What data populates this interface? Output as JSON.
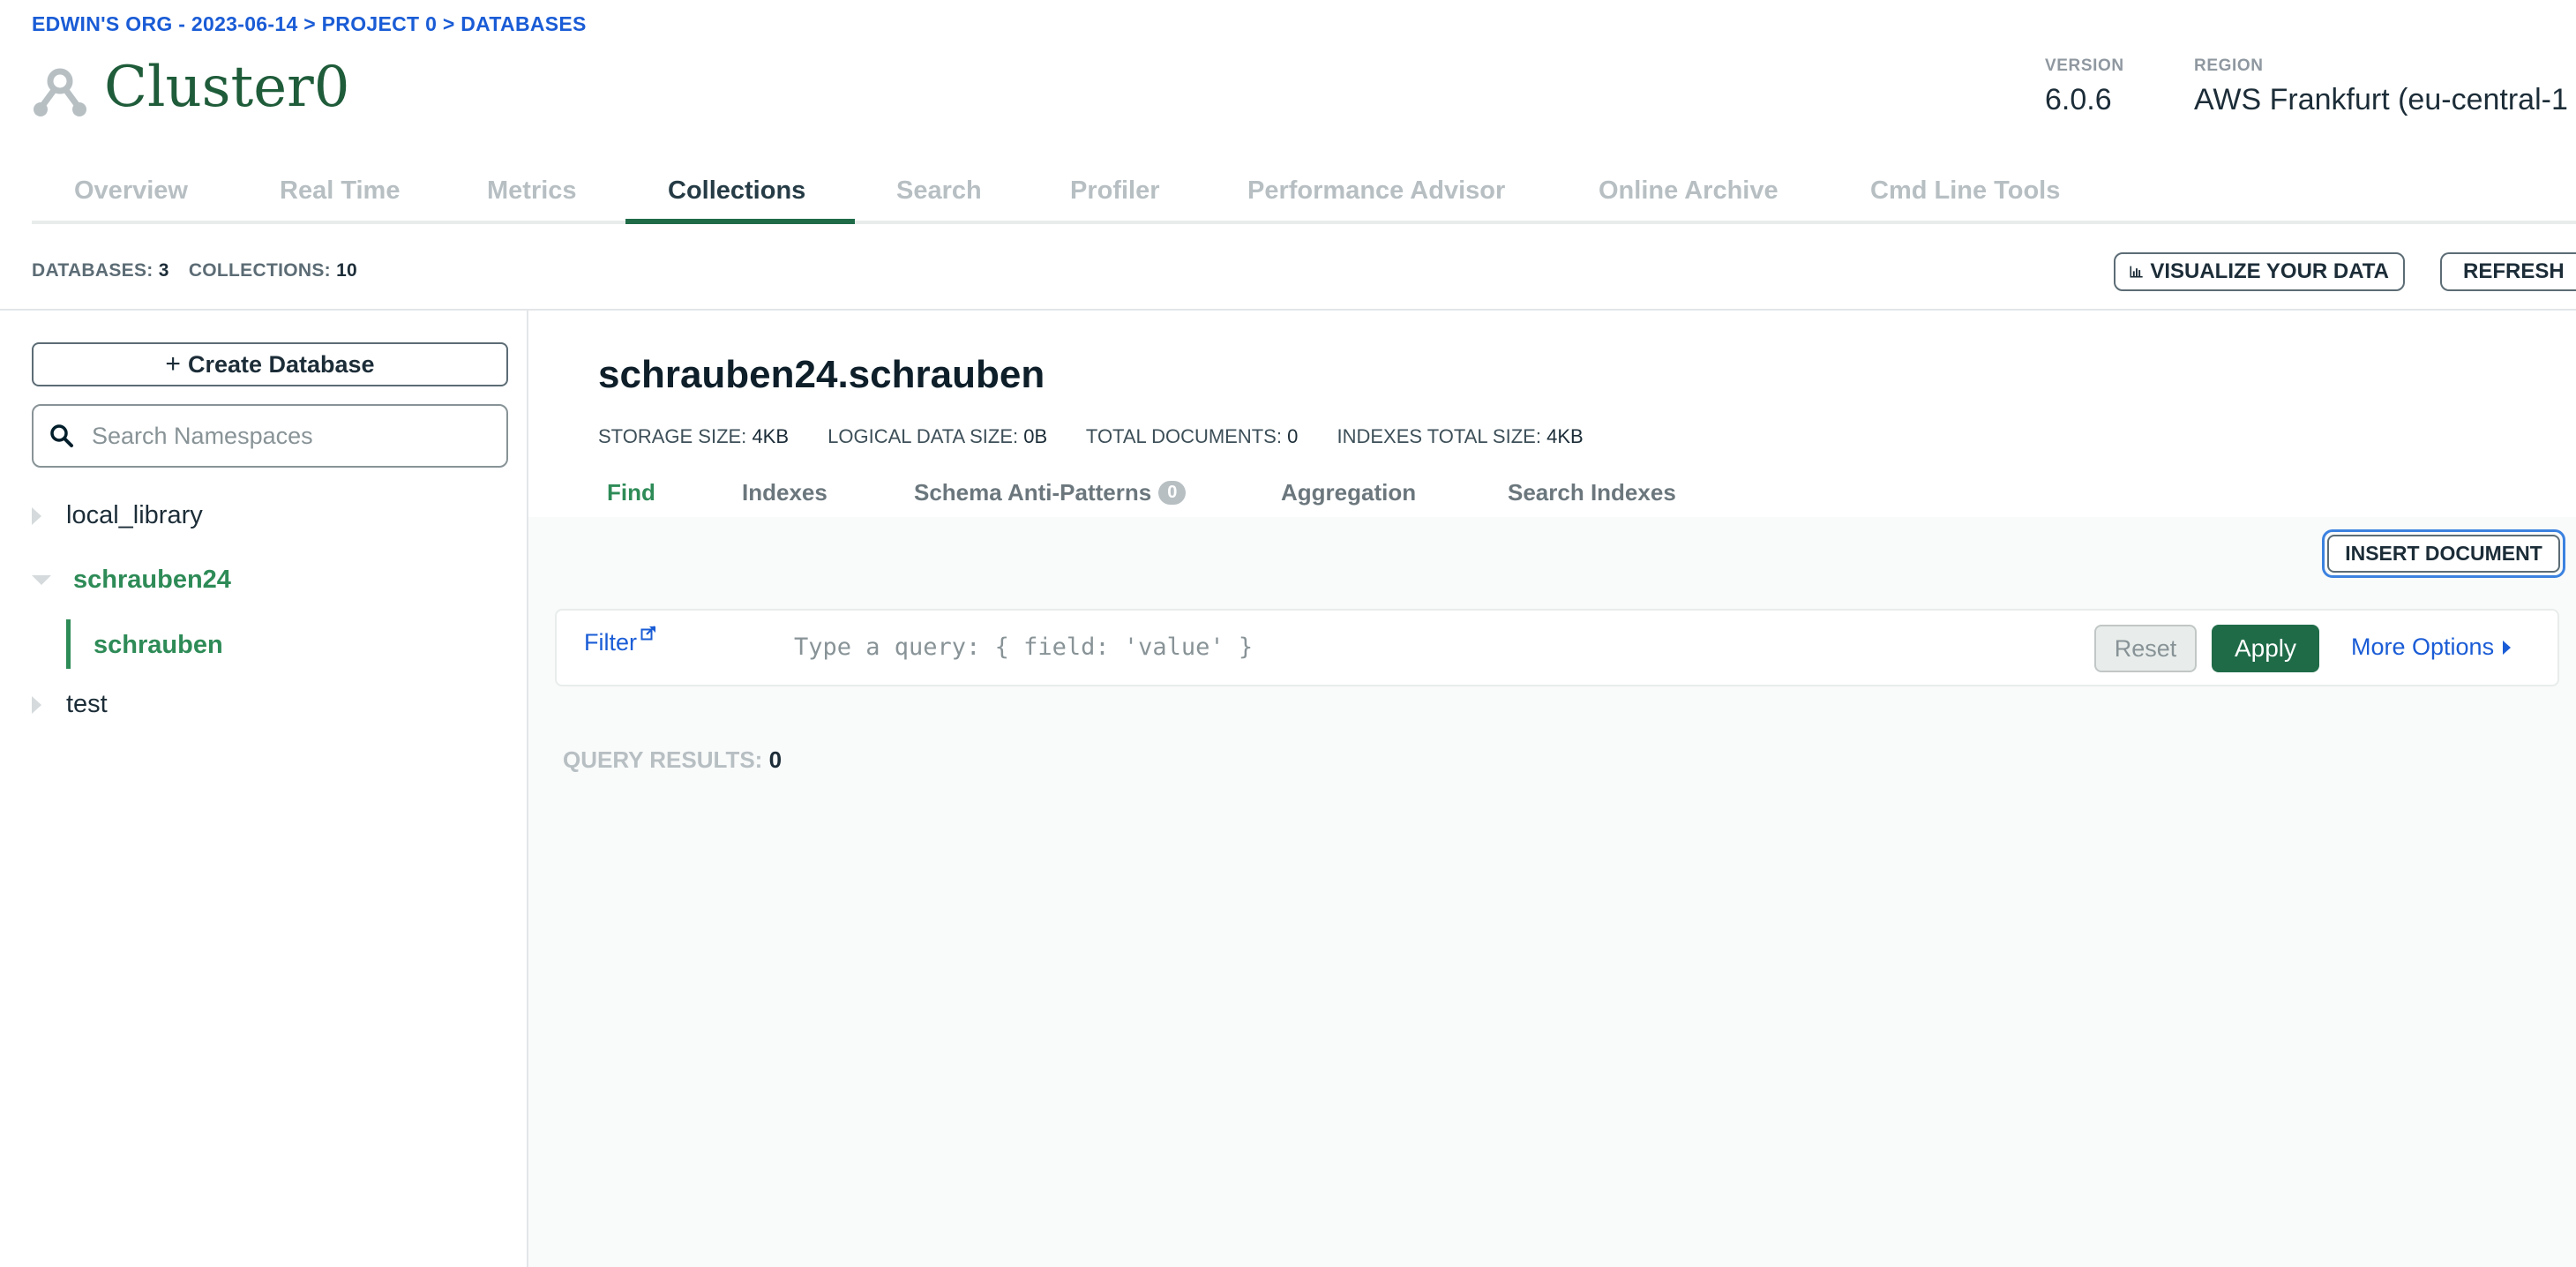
{
  "breadcrumb": "EDWIN'S ORG - 2023-06-14 > PROJECT 0 > DATABASES",
  "cluster": {
    "name": "Cluster0",
    "version_label": "VERSION",
    "version": "6.0.6",
    "region_label": "REGION",
    "region": "AWS Frankfurt (eu-central-1"
  },
  "nav_tabs": [
    "Overview",
    "Real Time",
    "Metrics",
    "Collections",
    "Search",
    "Profiler",
    "Performance Advisor",
    "Online Archive",
    "Cmd Line Tools"
  ],
  "active_nav_tab": "Collections",
  "counts": {
    "databases_label": "DATABASES:",
    "databases": "3",
    "collections_label": "COLLECTIONS:",
    "collections": "10"
  },
  "toolbar": {
    "visualize_label": "VISUALIZE YOUR DATA",
    "refresh_label": "REFRESH"
  },
  "sidebar": {
    "create_db_label": "Create Database",
    "search_placeholder": "Search Namespaces",
    "databases": [
      {
        "name": "local_library",
        "expanded": false
      },
      {
        "name": "schrauben24",
        "expanded": true,
        "collections": [
          "schrauben"
        ]
      },
      {
        "name": "test",
        "expanded": false
      }
    ]
  },
  "namespace": {
    "title": "schrauben24.schrauben",
    "storage_label": "STORAGE SIZE:",
    "storage": "4KB",
    "logical_label": "LOGICAL DATA SIZE:",
    "logical": "0B",
    "docs_label": "TOTAL DOCUMENTS:",
    "docs": "0",
    "indexes_label": "INDEXES TOTAL SIZE:",
    "indexes": "4KB"
  },
  "sub_tabs": {
    "find": "Find",
    "indexes": "Indexes",
    "schema": "Schema Anti-Patterns",
    "schema_badge": "0",
    "aggregation": "Aggregation",
    "search_indexes": "Search Indexes"
  },
  "insert_document_label": "INSERT DOCUMENT",
  "query": {
    "filter_label": "Filter",
    "placeholder": "Type a query: { field: 'value' }",
    "reset_label": "Reset",
    "apply_label": "Apply",
    "more_options_label": "More Options"
  },
  "results": {
    "label": "QUERY RESULTS:",
    "count": "0"
  },
  "colors": {
    "accent_green": "#1f6b48",
    "link_blue": "#1a5cd6",
    "active_green": "#2e8b57"
  }
}
